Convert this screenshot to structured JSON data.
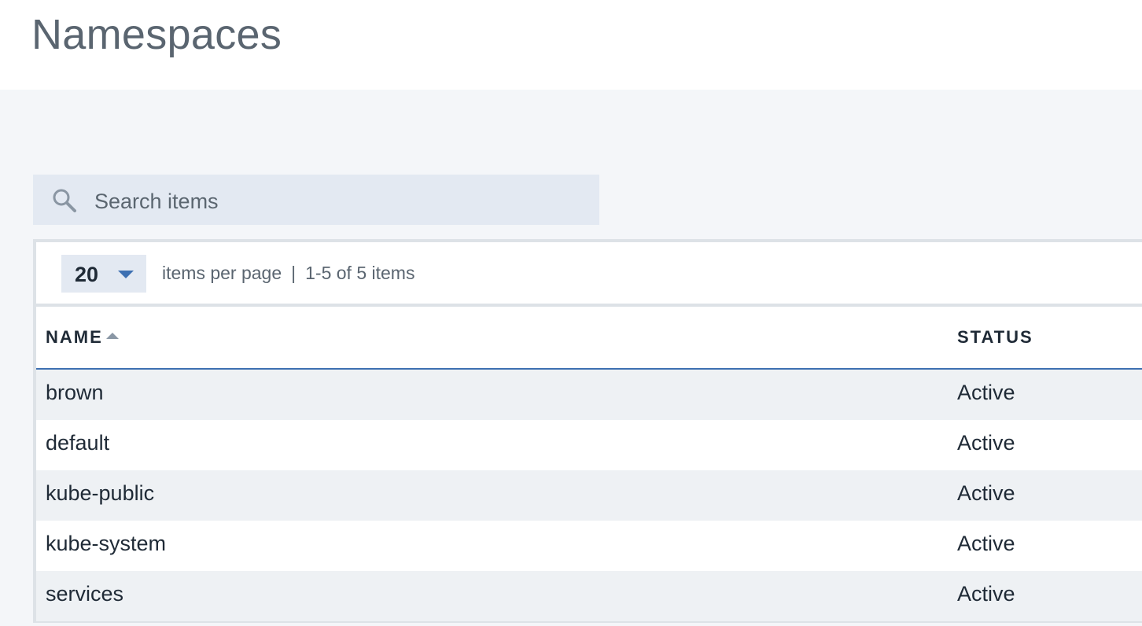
{
  "page": {
    "title": "Namespaces"
  },
  "search": {
    "placeholder": "Search items",
    "icon": "search-icon"
  },
  "pagination": {
    "per_page": "20",
    "per_page_label": "items per page",
    "separator": "|",
    "range_label": "1-5 of 5 items"
  },
  "table": {
    "columns": [
      {
        "label": "NAME",
        "sorted": "ascending"
      },
      {
        "label": "STATUS"
      }
    ],
    "rows": [
      {
        "name": "brown",
        "status": "Active"
      },
      {
        "name": "default",
        "status": "Active"
      },
      {
        "name": "kube-public",
        "status": "Active"
      },
      {
        "name": "kube-system",
        "status": "Active"
      },
      {
        "name": "services",
        "status": "Active"
      }
    ]
  },
  "colors": {
    "accent": "#3d70b2",
    "search_bg": "#e3e9f2",
    "stripe": "#eef1f4",
    "page_bg": "#f4f6f9"
  }
}
